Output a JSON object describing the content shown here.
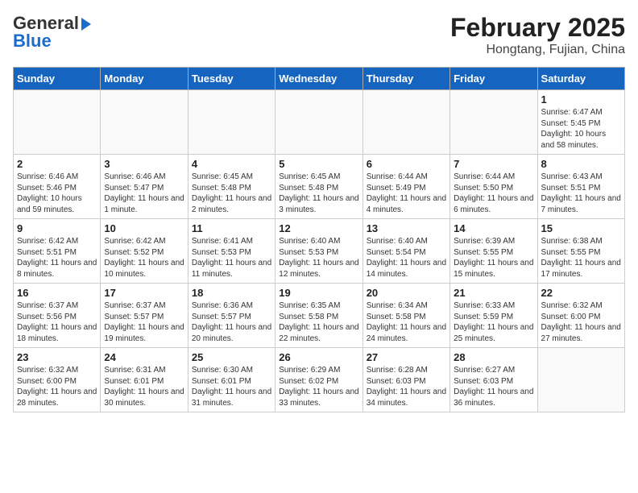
{
  "logo": {
    "line1": "General",
    "line2": "Blue",
    "arrow": "►"
  },
  "title": "February 2025",
  "subtitle": "Hongtang, Fujian, China",
  "days": [
    "Sunday",
    "Monday",
    "Tuesday",
    "Wednesday",
    "Thursday",
    "Friday",
    "Saturday"
  ],
  "weeks": [
    [
      {
        "day": "",
        "info": ""
      },
      {
        "day": "",
        "info": ""
      },
      {
        "day": "",
        "info": ""
      },
      {
        "day": "",
        "info": ""
      },
      {
        "day": "",
        "info": ""
      },
      {
        "day": "",
        "info": ""
      },
      {
        "day": "1",
        "info": "Sunrise: 6:47 AM\nSunset: 5:45 PM\nDaylight: 10 hours and 58 minutes."
      }
    ],
    [
      {
        "day": "2",
        "info": "Sunrise: 6:46 AM\nSunset: 5:46 PM\nDaylight: 10 hours and 59 minutes."
      },
      {
        "day": "3",
        "info": "Sunrise: 6:46 AM\nSunset: 5:47 PM\nDaylight: 11 hours and 1 minute."
      },
      {
        "day": "4",
        "info": "Sunrise: 6:45 AM\nSunset: 5:48 PM\nDaylight: 11 hours and 2 minutes."
      },
      {
        "day": "5",
        "info": "Sunrise: 6:45 AM\nSunset: 5:48 PM\nDaylight: 11 hours and 3 minutes."
      },
      {
        "day": "6",
        "info": "Sunrise: 6:44 AM\nSunset: 5:49 PM\nDaylight: 11 hours and 4 minutes."
      },
      {
        "day": "7",
        "info": "Sunrise: 6:44 AM\nSunset: 5:50 PM\nDaylight: 11 hours and 6 minutes."
      },
      {
        "day": "8",
        "info": "Sunrise: 6:43 AM\nSunset: 5:51 PM\nDaylight: 11 hours and 7 minutes."
      }
    ],
    [
      {
        "day": "9",
        "info": "Sunrise: 6:42 AM\nSunset: 5:51 PM\nDaylight: 11 hours and 8 minutes."
      },
      {
        "day": "10",
        "info": "Sunrise: 6:42 AM\nSunset: 5:52 PM\nDaylight: 11 hours and 10 minutes."
      },
      {
        "day": "11",
        "info": "Sunrise: 6:41 AM\nSunset: 5:53 PM\nDaylight: 11 hours and 11 minutes."
      },
      {
        "day": "12",
        "info": "Sunrise: 6:40 AM\nSunset: 5:53 PM\nDaylight: 11 hours and 12 minutes."
      },
      {
        "day": "13",
        "info": "Sunrise: 6:40 AM\nSunset: 5:54 PM\nDaylight: 11 hours and 14 minutes."
      },
      {
        "day": "14",
        "info": "Sunrise: 6:39 AM\nSunset: 5:55 PM\nDaylight: 11 hours and 15 minutes."
      },
      {
        "day": "15",
        "info": "Sunrise: 6:38 AM\nSunset: 5:55 PM\nDaylight: 11 hours and 17 minutes."
      }
    ],
    [
      {
        "day": "16",
        "info": "Sunrise: 6:37 AM\nSunset: 5:56 PM\nDaylight: 11 hours and 18 minutes."
      },
      {
        "day": "17",
        "info": "Sunrise: 6:37 AM\nSunset: 5:57 PM\nDaylight: 11 hours and 19 minutes."
      },
      {
        "day": "18",
        "info": "Sunrise: 6:36 AM\nSunset: 5:57 PM\nDaylight: 11 hours and 20 minutes."
      },
      {
        "day": "19",
        "info": "Sunrise: 6:35 AM\nSunset: 5:58 PM\nDaylight: 11 hours and 22 minutes."
      },
      {
        "day": "20",
        "info": "Sunrise: 6:34 AM\nSunset: 5:58 PM\nDaylight: 11 hours and 24 minutes."
      },
      {
        "day": "21",
        "info": "Sunrise: 6:33 AM\nSunset: 5:59 PM\nDaylight: 11 hours and 25 minutes."
      },
      {
        "day": "22",
        "info": "Sunrise: 6:32 AM\nSunset: 6:00 PM\nDaylight: 11 hours and 27 minutes."
      }
    ],
    [
      {
        "day": "23",
        "info": "Sunrise: 6:32 AM\nSunset: 6:00 PM\nDaylight: 11 hours and 28 minutes."
      },
      {
        "day": "24",
        "info": "Sunrise: 6:31 AM\nSunset: 6:01 PM\nDaylight: 11 hours and 30 minutes."
      },
      {
        "day": "25",
        "info": "Sunrise: 6:30 AM\nSunset: 6:01 PM\nDaylight: 11 hours and 31 minutes."
      },
      {
        "day": "26",
        "info": "Sunrise: 6:29 AM\nSunset: 6:02 PM\nDaylight: 11 hours and 33 minutes."
      },
      {
        "day": "27",
        "info": "Sunrise: 6:28 AM\nSunset: 6:03 PM\nDaylight: 11 hours and 34 minutes."
      },
      {
        "day": "28",
        "info": "Sunrise: 6:27 AM\nSunset: 6:03 PM\nDaylight: 11 hours and 36 minutes."
      },
      {
        "day": "",
        "info": ""
      }
    ]
  ]
}
